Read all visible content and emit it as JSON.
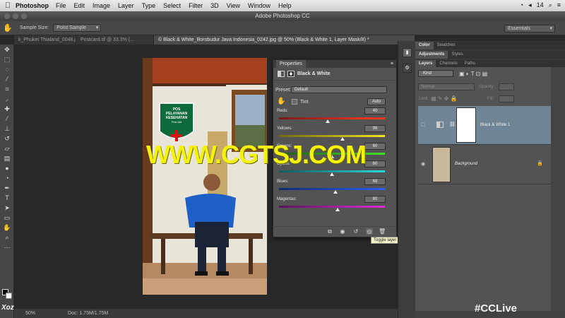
{
  "menubar": {
    "app_name": "Photoshop",
    "items": [
      "File",
      "Edit",
      "Image",
      "Layer",
      "Type",
      "Select",
      "Filter",
      "3D",
      "View",
      "Window",
      "Help"
    ],
    "date": "14"
  },
  "window": {
    "title": "Adobe Photoshop CC"
  },
  "options": {
    "sample_size_label": "Sample Size:",
    "sample_size_value": "Point Sample",
    "workspace": "Essentials"
  },
  "tabs": [
    {
      "label": "k_Phuket Thialand_0048.jpg"
    },
    {
      "label": "Postcard.tif @ 33.3% (..."
    },
    {
      "label": "© Black & White_Borobudur Java Indonesia_0242.jpg @ 50% (Black & White 1, Layer Mask/8) *"
    }
  ],
  "status": {
    "zoom": "50%",
    "doc": "Doc: 1.75M/1.75M"
  },
  "properties": {
    "tab": "Properties",
    "type": "Black & White",
    "preset_label": "Preset:",
    "preset_value": "Default",
    "tint_label": "Tint",
    "auto_label": "Auto",
    "sliders": [
      {
        "label": "Reds:",
        "value": "40",
        "pos": 0.46
      },
      {
        "label": "Yellows:",
        "value": "96",
        "pos": 0.6
      },
      {
        "label": "Greens:",
        "value": "60",
        "pos": 0.5
      },
      {
        "label": "Cyans:",
        "value": "60",
        "pos": 0.5
      },
      {
        "label": "Blues:",
        "value": "68",
        "pos": 0.53
      },
      {
        "label": "Magentas:",
        "value": "80",
        "pos": 0.55
      }
    ],
    "tooltip": "Toggle layer visibility"
  },
  "right": {
    "tabs_top": [
      "Color",
      "Swatches"
    ],
    "tabs_mid": [
      "Adjustments",
      "Styles"
    ],
    "tabs_layers": [
      "Layers",
      "Channels",
      "Paths"
    ],
    "kind": "Kind",
    "blend": "Normal",
    "opacity_label": "Opacity:",
    "lock_label": "Lock:",
    "fill_label": "Fill:",
    "layers": [
      {
        "name": "Black & White 1"
      },
      {
        "name": "Background"
      }
    ]
  },
  "photo": {
    "sign_line1": "POS",
    "sign_line2": "PELAYANAN",
    "sign_line3": "KESEHATAN",
    "sign_line4": "First Aid"
  },
  "watermark": "WWW.CGTSJ.COM",
  "brand_bottom": "#CCLive",
  "brand_left": "Xoz"
}
